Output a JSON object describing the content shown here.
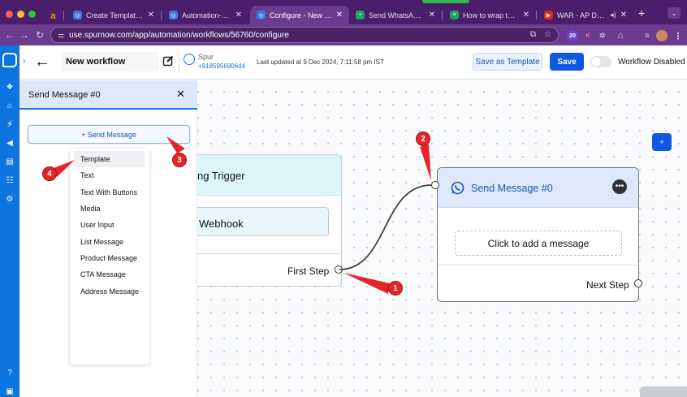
{
  "browser": {
    "tabs": [
      {
        "label": "",
        "favicon": "a",
        "favicon_color": "#f29100"
      },
      {
        "label": "Create Template user_a",
        "favicon": "◎"
      },
      {
        "label": "Automation-Flows",
        "favicon": "◎"
      },
      {
        "label": "Configure - New workflo",
        "favicon": "◎",
        "active": true
      },
      {
        "label": "Send WhatsApp Messag",
        "favicon": "+"
      },
      {
        "label": "How to wrap text in Goo",
        "favicon": "≡"
      },
      {
        "label": "WAR - AP DHILLON |",
        "favicon": "▶"
      }
    ],
    "new_tab_symbol": "+",
    "url": "use.spurnow.com/app/automation/workflows/56760/configure",
    "extension_badge": "20",
    "extension_k": "K"
  },
  "header": {
    "workflow_name": "New workflow",
    "channel_name": "Spur",
    "channel_phone": "+918595690644",
    "last_updated": "Last updated at 9 Dec 2024, 7:11:58 pm IST",
    "save_as_template_label": "Save as Template",
    "save_label": "Save",
    "workflow_status": "Workflow Disabled",
    "workflow_enabled": false
  },
  "panel": {
    "title": "Send Message #0",
    "close_symbol": "✕",
    "add_button_label": "+ Send Message",
    "menu_items": [
      "Template",
      "Text",
      "Text With Buttons",
      "Media",
      "User Input",
      "List Message",
      "Product Message",
      "CTA Message",
      "Address Message"
    ]
  },
  "trigger_node": {
    "title": "ng Trigger",
    "pill_label": "Webhook",
    "footer_label": "First Step"
  },
  "send_node": {
    "title": "Send Message #0",
    "add_message_label": "Click to add a message",
    "footer_label": "Next Step",
    "more_symbol": "•••"
  },
  "canvas": {
    "plus_symbol": "+"
  },
  "annotations": [
    "1",
    "2",
    "3",
    "4"
  ],
  "colors": {
    "primary": "#1158e1",
    "annotation_red": "#e5252a",
    "rail_blue": "#0d74e0",
    "browser_purple": "#6b3b8f"
  }
}
